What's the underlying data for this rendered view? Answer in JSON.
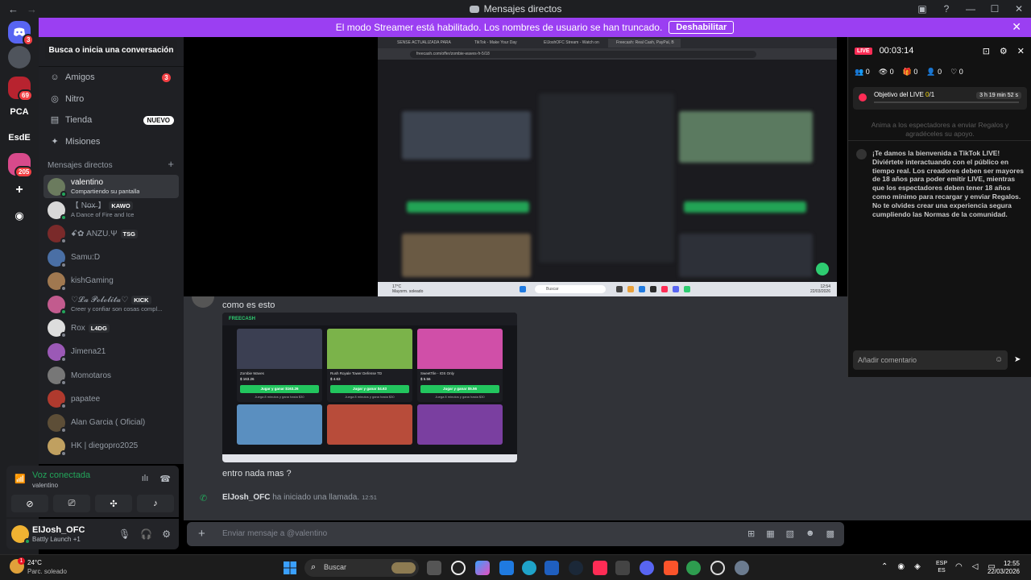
{
  "window": {
    "title": "Mensajes directos",
    "back": "←",
    "forward": "→"
  },
  "banner": {
    "message": "El modo Streamer está habilitado. Los nombres de usuario se han truncado.",
    "button": "Deshabilitar",
    "close": "✕"
  },
  "guilds": [
    {
      "label": "",
      "badge": "3",
      "color": "#5865f2"
    },
    {
      "label": "",
      "badge": "",
      "color": "#4f545c"
    },
    {
      "label": "",
      "badge": "69",
      "color": "#b8232f"
    },
    {
      "label": "PCA",
      "badge": "",
      "color": "#1e1f22"
    },
    {
      "label": "EsdE",
      "badge": "",
      "color": "#1e1f22"
    },
    {
      "label": "",
      "badge": "205",
      "color": "#d84a8b"
    }
  ],
  "sidebar": {
    "search": "Busca o inicia una conversación",
    "nav": [
      {
        "label": "Amigos",
        "count": "3",
        "tag": ""
      },
      {
        "label": "Nitro",
        "count": "",
        "tag": ""
      },
      {
        "label": "Tienda",
        "count": "",
        "tag": "NUEVO"
      },
      {
        "label": "Misiones",
        "count": "",
        "tag": ""
      }
    ],
    "dm_header": "Mensajes directos",
    "dm_add": "+",
    "dms": [
      {
        "name": "valentino",
        "sub": "Compartiendo su pantalla",
        "tag": "",
        "active": true,
        "avatar": "#6b7b5e",
        "status": "#23a55a"
      },
      {
        "name": "【 N̶o̶x̶ 】",
        "sub": "A Dance of Fire and Ice",
        "tag": "KAWO",
        "active": false,
        "avatar": "#d8d8d8",
        "status": "#23a55a"
      },
      {
        "name": "ꗃ✿ ANZU.Ψ",
        "sub": "",
        "tag": "TSG",
        "active": false,
        "avatar": "#7a2a2a",
        "status": "#80848e"
      },
      {
        "name": "Samu:D",
        "sub": "",
        "tag": "",
        "active": false,
        "avatar": "#4a6fa5",
        "status": "#80848e"
      },
      {
        "name": "kishGaming",
        "sub": "",
        "tag": "",
        "active": false,
        "avatar": "#a07850",
        "status": "#80848e"
      },
      {
        "name": "♡𝓛𝓪 𝓟𝓸𝓵𝓸𝓵𝓲𝓽𝓪♡",
        "sub": "Creer y confiar son cosas compl...",
        "tag": "KICK",
        "active": false,
        "avatar": "#c25b8e",
        "status": "#23a55a"
      },
      {
        "name": "Rox",
        "sub": "",
        "tag": "L4DG",
        "active": false,
        "avatar": "#dddddd",
        "status": "#80848e"
      },
      {
        "name": "Jimena21",
        "sub": "",
        "tag": "",
        "active": false,
        "avatar": "#9b59b6",
        "status": "#80848e"
      },
      {
        "name": "Momotaros",
        "sub": "",
        "tag": "",
        "active": false,
        "avatar": "#777777",
        "status": "#80848e"
      },
      {
        "name": "papatee",
        "sub": "",
        "tag": "",
        "active": false,
        "avatar": "#b03a2e",
        "status": "#80848e"
      },
      {
        "name": "Alan Garcia ( Oficial)",
        "sub": "",
        "tag": "",
        "active": false,
        "avatar": "#5d4e37",
        "status": "#80848e"
      },
      {
        "name": "HK | diegopro2025",
        "sub": "",
        "tag": "",
        "active": false,
        "avatar": "#c0a060",
        "status": "#80848e"
      }
    ]
  },
  "voice": {
    "status": "Voz conectada",
    "channel": "valentino"
  },
  "user": {
    "name": "ElJosh_OFC",
    "status": "Battly Launch +1"
  },
  "stream": {
    "tabs": [
      "SENSE ACTUALIZADA PARA R!!",
      "TikTok - Make Your Day",
      "EIJoshOFC Stream - Watch on",
      "Freecash: Real Cash, PayPal, B"
    ],
    "url": "freecash.com/offer/zombie-waves-fr-5/18",
    "task_search": "Buscar",
    "task_temp": "17°C",
    "task_cond": "Mayorm. soleado",
    "task_time": "12:54",
    "task_date": "22/03/2026"
  },
  "chat": {
    "msg1": "como es esto",
    "msg2": "entro nada mas ?",
    "call_user": "ElJosh_OFC",
    "call_text": "ha iniciado una llamada.",
    "call_time": "12:51",
    "composer_placeholder": "Enviar mensaje a @valentino",
    "attachment": {
      "logo": "FREECASH",
      "cards": [
        {
          "title": "Zombie Waves",
          "price": "$ 163.26",
          "button": "Jugar y ganar $163.26",
          "foot": "Juega 8 minutos y gana hasta $30",
          "color": "#3b3f52"
        },
        {
          "title": "Rush Royale Tower Defense TD",
          "price": "$ 4.63",
          "button": "Jugar y ganar $4.63",
          "foot": "Juega 8 minutos y gana hasta $30",
          "color": "#7bb34a"
        },
        {
          "title": "SweetTile - IOS Only",
          "price": "$ 5.56",
          "button": "Jugar y ganar $5.56",
          "foot": "Juega 8 minutos y gana hasta $30",
          "color": "#d04fa8"
        }
      ]
    }
  },
  "live": {
    "badge": "LIVE",
    "time": "00:03:14",
    "stats": [
      "0",
      "0",
      "0",
      "0",
      "0"
    ],
    "goal_label": "Objetivo del LIVE",
    "goal_progress": "0",
    "goal_total": "/1",
    "goal_remaining": "3 h 19 min 52 s",
    "hint": "Anima a los espectadores a enviar Regalos y agradéceles su apoyo.",
    "welcome": "¡Te damos la bienvenida a TikTok LIVE! Diviértete interactuando con el público en tiempo real. Los creadores deben ser mayores de 18 años para poder emitir LIVE, mientras que los espectadores deben tener 18 años como mínimo para recargar y enviar Regalos. No te olvides crear una experiencia segura cumpliendo las Normas de la comunidad.",
    "comment_placeholder": "Añadir comentario"
  },
  "taskbar": {
    "weather_temp": "24°C",
    "weather_cond": "Parc. soleado",
    "weather_badge": "1",
    "search": "Buscar",
    "lang1": "ESP",
    "lang2": "ES",
    "time": "12:55",
    "date": "22/03/2026"
  }
}
